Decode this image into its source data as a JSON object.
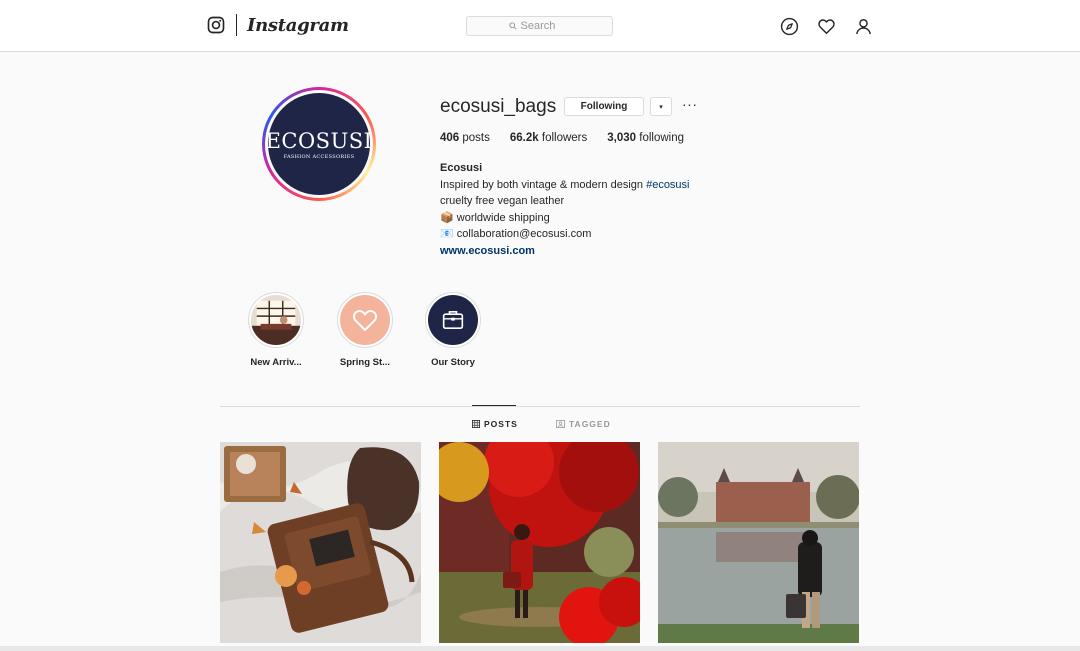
{
  "nav": {
    "brand": "Instagram",
    "search_placeholder": "Search"
  },
  "profile": {
    "username": "ecosusi_bags",
    "following_label": "Following",
    "dropdown_glyph": "▾",
    "more_glyph": "···",
    "avatar": {
      "brand": "ECOSUSI",
      "tagline": "FASHION ACCESSORIES"
    },
    "stats": [
      {
        "value": "406",
        "label": "posts"
      },
      {
        "value": "66.2k",
        "label": "followers"
      },
      {
        "value": "3,030",
        "label": "following"
      }
    ],
    "bio": {
      "full_name": "Ecosusi",
      "line1_text": "Inspired by both vintage & modern design ",
      "line1_hashtag": "#ecosusi",
      "line2": "cruelty free vegan leather",
      "line3_emoji": "📦",
      "line3": "worldwide shipping",
      "line4_emoji": "📧",
      "line4": "collaboration@ecosusi.com",
      "website": "www.ecosusi.com"
    }
  },
  "highlights": [
    {
      "label": "New Arriv..."
    },
    {
      "label": "Spring St..."
    },
    {
      "label": "Our Story"
    }
  ],
  "tabs": [
    {
      "label": "POSTS",
      "active": true
    },
    {
      "label": "TAGGED",
      "active": false
    }
  ],
  "colors": {
    "avatar_bg": "#1f2546",
    "link": "#003569",
    "border": "#dbdbdb",
    "highlight_pink": "#f4b39b"
  }
}
